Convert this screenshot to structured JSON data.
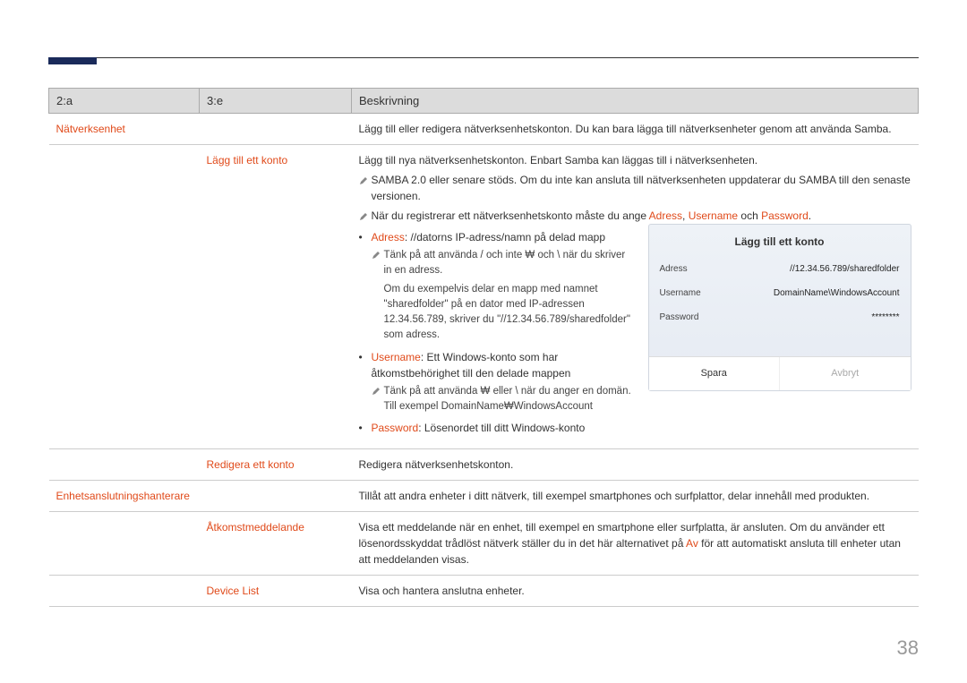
{
  "header": {
    "col1": "2:a",
    "col2": "3:e",
    "col3": "Beskrivning"
  },
  "rows": [
    {
      "c1": "Nätverksenhet",
      "c2": "",
      "desc": "Lägg till eller redigera nätverksenhetskonton. Du kan bara lägga till nätverksenheter genom att använda Samba."
    },
    {
      "c1": "",
      "c2": "Lägg till ett konto",
      "desc_intro": "Lägg till nya nätverksenhetskonton. Enbart Samba kan läggas till i nätverksenheten.",
      "notes": [
        "SAMBA 2.0 eller senare stöds. Om du inte kan ansluta till nätverksenheten uppdaterar du SAMBA till den senaste versionen.",
        {
          "pre": "När du registrerar ett nätverksenhetskonto måste du ange ",
          "k1": "Adress",
          "mid": ", ",
          "k2": "Username",
          "mid2": " och ",
          "k3": "Password",
          "post": "."
        }
      ],
      "bullets": [
        {
          "label": "Adress",
          "text": ": //datorns IP-adress/namn på delad mapp",
          "subs": [
            "Tänk på att använda / och inte ₩ och \\ när du skriver in en adress.",
            "Om du exempelvis delar en mapp med namnet \"sharedfolder\" på en dator med IP-adressen 12.34.56.789, skriver du \"//12.34.56.789/sharedfolder\" som adress."
          ]
        },
        {
          "label": "Username",
          "text": ": Ett Windows-konto som har åtkomstbehörighet till den delade mappen",
          "subs": [
            "Tänk på att använda ₩ eller \\ när du anger en domän. Till exempel DomainName₩WindowsAccount"
          ]
        },
        {
          "label": "Password",
          "text": ": Lösenordet till ditt Windows-konto",
          "subs": []
        }
      ]
    },
    {
      "c1": "",
      "c2": "Redigera ett konto",
      "desc": "Redigera nätverksenhetskonton."
    },
    {
      "c1": "Enhetsanslutningshanterare",
      "c2": "",
      "desc": "Tillåt att andra enheter i ditt nätverk, till exempel smartphones och surfplattor, delar innehåll med produkten."
    },
    {
      "c1": "",
      "c2": "Åtkomstmeddelande",
      "desc_pre": "Visa ett meddelande när en enhet, till exempel en smartphone eller surfplatta, är ansluten. Om du använder ett lösenordsskyddat trådlöst nätverk ställer du in det här alternativet på ",
      "desc_key": "Av",
      "desc_post": " för att automatiskt ansluta till enheter utan att meddelanden visas."
    },
    {
      "c1": "",
      "c2": "Device List",
      "desc": "Visa och hantera anslutna enheter."
    }
  ],
  "dialog": {
    "title": "Lägg till ett konto",
    "rows": [
      {
        "k": "Adress",
        "v": "//12.34.56.789/sharedfolder"
      },
      {
        "k": "Username",
        "v": "DomainName\\WindowsAccount"
      },
      {
        "k": "Password",
        "v": "********"
      }
    ],
    "save": "Spara",
    "cancel": "Avbryt"
  },
  "page": "38"
}
